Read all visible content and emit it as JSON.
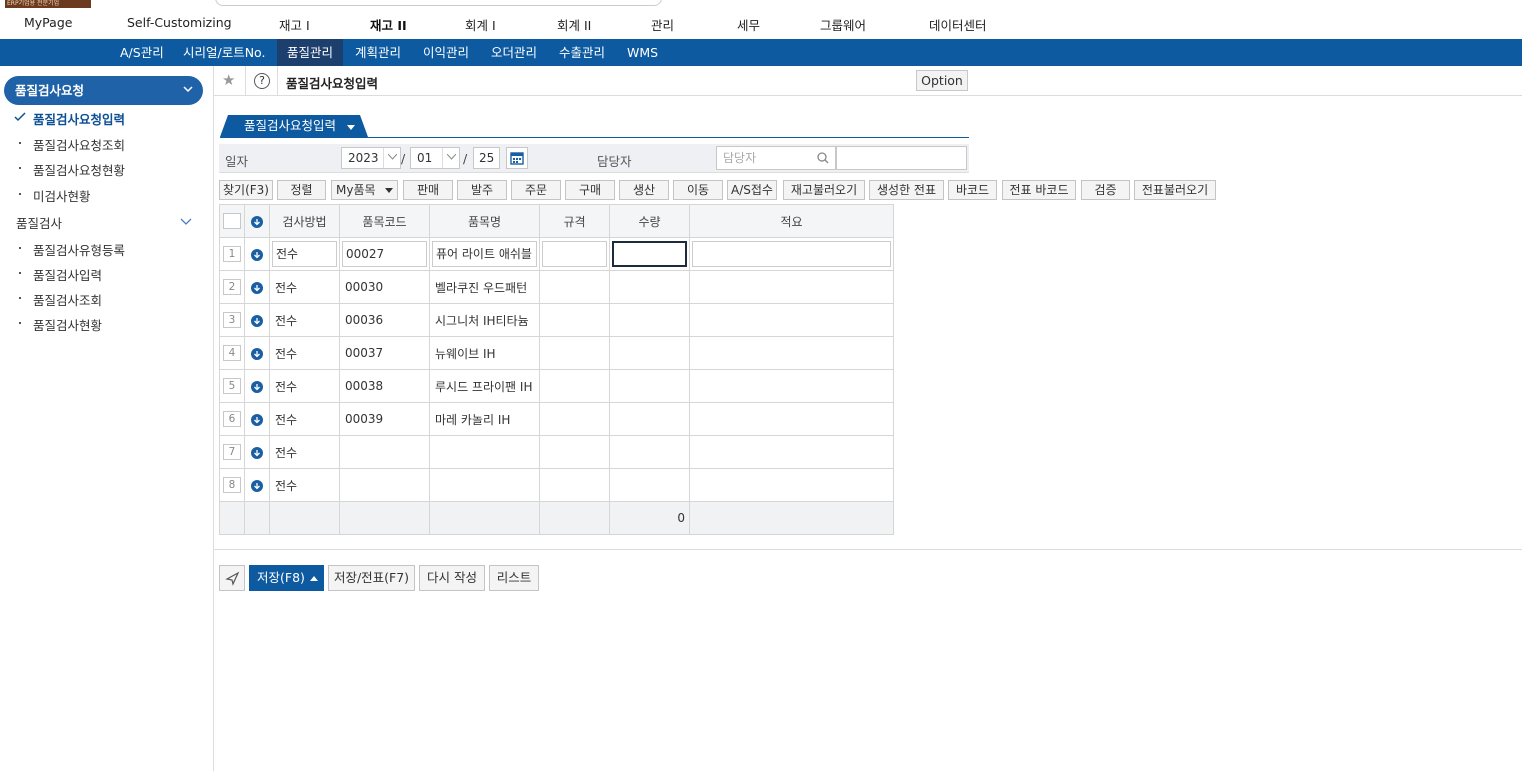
{
  "topbar": {
    "badge": "ERP기업용 전문기업"
  },
  "topnav": [
    "MyPage",
    "Self-Customizing",
    "재고 I",
    "재고 II",
    "회계 I",
    "회계 II",
    "관리",
    "세무",
    "그룹웨어",
    "데이터센터"
  ],
  "subnav": [
    "A/S관리",
    "시리얼/로트No.",
    "품질관리",
    "계획관리",
    "이익관리",
    "오더관리",
    "수출관리",
    "WMS"
  ],
  "sidebar": {
    "group1": "품질검사요청",
    "items1": [
      "품질검사요청입력",
      "품질검사요청조회",
      "품질검사요청현황",
      "미검사현황"
    ],
    "group2": "품질검사",
    "items2": [
      "품질검사유형등록",
      "품질검사입력",
      "품질검사조회",
      "품질검사현황"
    ]
  },
  "title": {
    "text": "품질검사요청입력",
    "option": "Option"
  },
  "tab": {
    "label": "품질검사요청입력"
  },
  "form": {
    "date_label": "일자",
    "year": "2023",
    "month": "01",
    "day": "25",
    "sep": "/",
    "manager_label": "담당자",
    "manager_placeholder": "담당자"
  },
  "buttons": [
    "찾기(F3)",
    "정렬",
    "My품목",
    "판매",
    "발주",
    "주문",
    "구매",
    "생산",
    "이동",
    "A/S접수",
    "재고불러오기",
    "생성한 전표",
    "바코드",
    "전표 바코드",
    "검증",
    "전표불러오기"
  ],
  "grid": {
    "headers": [
      "검사방법",
      "품목코드",
      "품목명",
      "규격",
      "수량",
      "적요"
    ],
    "rows": [
      {
        "n": "1",
        "method": "전수",
        "code": "00027",
        "name": "퓨어 라이트 애쉬블"
      },
      {
        "n": "2",
        "method": "전수",
        "code": "00030",
        "name": "벨라쿠진 우드패턴"
      },
      {
        "n": "3",
        "method": "전수",
        "code": "00036",
        "name": "시그니처 IH티타늄"
      },
      {
        "n": "4",
        "method": "전수",
        "code": "00037",
        "name": "뉴웨이브 IH"
      },
      {
        "n": "5",
        "method": "전수",
        "code": "00038",
        "name": "루시드 프라이팬 IH"
      },
      {
        "n": "6",
        "method": "전수",
        "code": "00039",
        "name": "마레 카놀리 IH"
      },
      {
        "n": "7",
        "method": "전수",
        "code": "",
        "name": ""
      },
      {
        "n": "8",
        "method": "전수",
        "code": "",
        "name": ""
      }
    ],
    "total_qty": "0"
  },
  "footer": {
    "save": "저장(F8)",
    "save_slip": "저장/전표(F7)",
    "rewrite": "다시 작성",
    "list": "리스트"
  }
}
